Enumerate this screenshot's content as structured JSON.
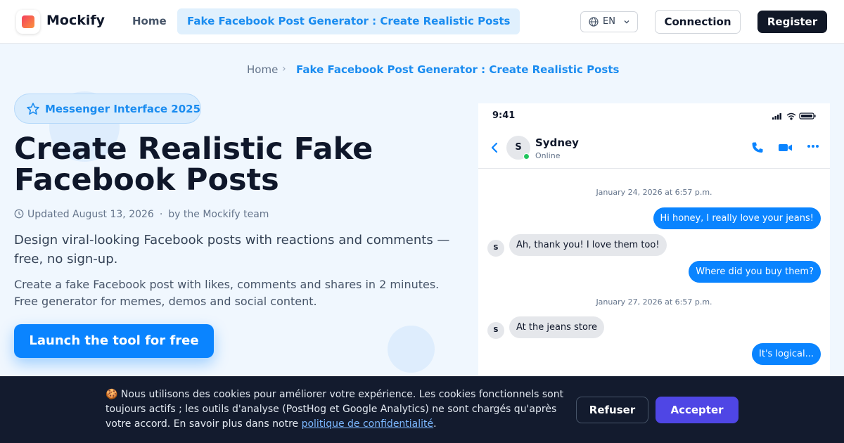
{
  "header": {
    "logo_text": "Mockify",
    "nav": {
      "home": "Home",
      "active": "Fake Facebook Post Generator : Create Realistic Posts"
    },
    "language": "EN",
    "connection": "Connection",
    "register": "Register"
  },
  "breadcrumb": {
    "home": "Home",
    "separator": "›",
    "current": "Fake Facebook Post Generator : Create Realistic Posts"
  },
  "hero": {
    "badge": "Messenger Interface 2025",
    "title": "Create Realistic Fake Facebook Posts",
    "updated": "Updated August 13, 2026",
    "meta_sep": "·",
    "author": "by the Mockify team",
    "lead": "Design viral-looking Facebook posts with reactions and comments — free, no sign-up.",
    "description": "Create a fake Facebook post with likes, comments and shares in 2 minutes. Free generator for memes, demos and social content.",
    "cta": "Launch the tool for free"
  },
  "phone": {
    "time": "9:41",
    "contact_initial": "S",
    "contact_name": "Sydney",
    "contact_status": "Online",
    "messages": [
      {
        "type": "timestamp",
        "text": "January 24, 2026 at 6:57 p.m."
      },
      {
        "type": "out",
        "text": "Hi honey, I really love your jeans!"
      },
      {
        "type": "in",
        "avatar": "S",
        "text": "Ah, thank you! I love them too!"
      },
      {
        "type": "out",
        "text": "Where did you buy them?"
      },
      {
        "type": "timestamp",
        "text": "January 27, 2026 at 6:57 p.m."
      },
      {
        "type": "in",
        "avatar": "S",
        "text": "At the jeans store"
      },
      {
        "type": "out",
        "text": "It's logical..."
      }
    ]
  },
  "cookie": {
    "text": "🍪 Nous utilisons des cookies pour améliorer votre expérience. Les cookies fonctionnels sont toujours actifs ; les outils d'analyse (PostHog et Google Analytics) ne sont chargés qu'après votre accord. En savoir plus dans notre ",
    "link": "politique de confidentialité",
    "after_link": ".",
    "refuse": "Refuser",
    "accept": "Accepter"
  },
  "colors": {
    "accent": "#1a8cf0",
    "messenger_blue": "#0a84ff",
    "dark": "#111827",
    "accept": "#4f46e5",
    "banner_bg": "#131b2e"
  },
  "icons": [
    "globe-icon",
    "chevron-down-icon",
    "star-icon",
    "clock-icon",
    "signal-icon",
    "wifi-icon",
    "battery-icon",
    "back-arrow-icon",
    "phone-icon",
    "video-icon",
    "more-icon"
  ]
}
